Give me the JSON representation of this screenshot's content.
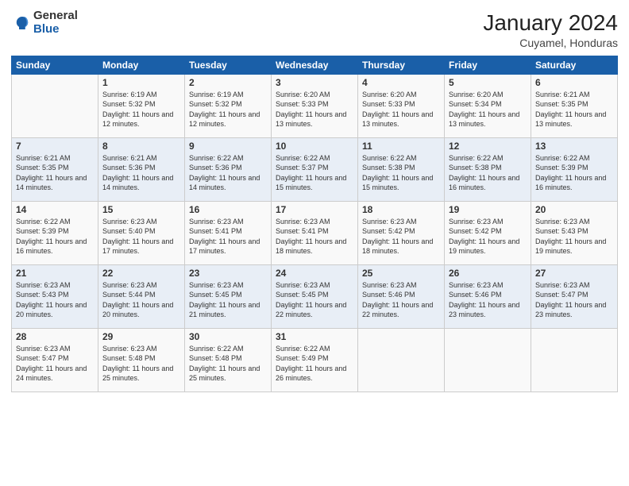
{
  "header": {
    "logo_general": "General",
    "logo_blue": "Blue",
    "title": "January 2024",
    "location": "Cuyamel, Honduras"
  },
  "weekdays": [
    "Sunday",
    "Monday",
    "Tuesday",
    "Wednesday",
    "Thursday",
    "Friday",
    "Saturday"
  ],
  "weeks": [
    [
      {
        "day": "",
        "sunrise": "",
        "sunset": "",
        "daylight": ""
      },
      {
        "day": "1",
        "sunrise": "6:19 AM",
        "sunset": "5:32 PM",
        "daylight": "11 hours and 12 minutes."
      },
      {
        "day": "2",
        "sunrise": "6:19 AM",
        "sunset": "5:32 PM",
        "daylight": "11 hours and 12 minutes."
      },
      {
        "day": "3",
        "sunrise": "6:20 AM",
        "sunset": "5:33 PM",
        "daylight": "11 hours and 13 minutes."
      },
      {
        "day": "4",
        "sunrise": "6:20 AM",
        "sunset": "5:33 PM",
        "daylight": "11 hours and 13 minutes."
      },
      {
        "day": "5",
        "sunrise": "6:20 AM",
        "sunset": "5:34 PM",
        "daylight": "11 hours and 13 minutes."
      },
      {
        "day": "6",
        "sunrise": "6:21 AM",
        "sunset": "5:35 PM",
        "daylight": "11 hours and 13 minutes."
      }
    ],
    [
      {
        "day": "7",
        "sunrise": "6:21 AM",
        "sunset": "5:35 PM",
        "daylight": "11 hours and 14 minutes."
      },
      {
        "day": "8",
        "sunrise": "6:21 AM",
        "sunset": "5:36 PM",
        "daylight": "11 hours and 14 minutes."
      },
      {
        "day": "9",
        "sunrise": "6:22 AM",
        "sunset": "5:36 PM",
        "daylight": "11 hours and 14 minutes."
      },
      {
        "day": "10",
        "sunrise": "6:22 AM",
        "sunset": "5:37 PM",
        "daylight": "11 hours and 15 minutes."
      },
      {
        "day": "11",
        "sunrise": "6:22 AM",
        "sunset": "5:38 PM",
        "daylight": "11 hours and 15 minutes."
      },
      {
        "day": "12",
        "sunrise": "6:22 AM",
        "sunset": "5:38 PM",
        "daylight": "11 hours and 16 minutes."
      },
      {
        "day": "13",
        "sunrise": "6:22 AM",
        "sunset": "5:39 PM",
        "daylight": "11 hours and 16 minutes."
      }
    ],
    [
      {
        "day": "14",
        "sunrise": "6:22 AM",
        "sunset": "5:39 PM",
        "daylight": "11 hours and 16 minutes."
      },
      {
        "day": "15",
        "sunrise": "6:23 AM",
        "sunset": "5:40 PM",
        "daylight": "11 hours and 17 minutes."
      },
      {
        "day": "16",
        "sunrise": "6:23 AM",
        "sunset": "5:41 PM",
        "daylight": "11 hours and 17 minutes."
      },
      {
        "day": "17",
        "sunrise": "6:23 AM",
        "sunset": "5:41 PM",
        "daylight": "11 hours and 18 minutes."
      },
      {
        "day": "18",
        "sunrise": "6:23 AM",
        "sunset": "5:42 PM",
        "daylight": "11 hours and 18 minutes."
      },
      {
        "day": "19",
        "sunrise": "6:23 AM",
        "sunset": "5:42 PM",
        "daylight": "11 hours and 19 minutes."
      },
      {
        "day": "20",
        "sunrise": "6:23 AM",
        "sunset": "5:43 PM",
        "daylight": "11 hours and 19 minutes."
      }
    ],
    [
      {
        "day": "21",
        "sunrise": "6:23 AM",
        "sunset": "5:43 PM",
        "daylight": "11 hours and 20 minutes."
      },
      {
        "day": "22",
        "sunrise": "6:23 AM",
        "sunset": "5:44 PM",
        "daylight": "11 hours and 20 minutes."
      },
      {
        "day": "23",
        "sunrise": "6:23 AM",
        "sunset": "5:45 PM",
        "daylight": "11 hours and 21 minutes."
      },
      {
        "day": "24",
        "sunrise": "6:23 AM",
        "sunset": "5:45 PM",
        "daylight": "11 hours and 22 minutes."
      },
      {
        "day": "25",
        "sunrise": "6:23 AM",
        "sunset": "5:46 PM",
        "daylight": "11 hours and 22 minutes."
      },
      {
        "day": "26",
        "sunrise": "6:23 AM",
        "sunset": "5:46 PM",
        "daylight": "11 hours and 23 minutes."
      },
      {
        "day": "27",
        "sunrise": "6:23 AM",
        "sunset": "5:47 PM",
        "daylight": "11 hours and 23 minutes."
      }
    ],
    [
      {
        "day": "28",
        "sunrise": "6:23 AM",
        "sunset": "5:47 PM",
        "daylight": "11 hours and 24 minutes."
      },
      {
        "day": "29",
        "sunrise": "6:23 AM",
        "sunset": "5:48 PM",
        "daylight": "11 hours and 25 minutes."
      },
      {
        "day": "30",
        "sunrise": "6:22 AM",
        "sunset": "5:48 PM",
        "daylight": "11 hours and 25 minutes."
      },
      {
        "day": "31",
        "sunrise": "6:22 AM",
        "sunset": "5:49 PM",
        "daylight": "11 hours and 26 minutes."
      },
      {
        "day": "",
        "sunrise": "",
        "sunset": "",
        "daylight": ""
      },
      {
        "day": "",
        "sunrise": "",
        "sunset": "",
        "daylight": ""
      },
      {
        "day": "",
        "sunrise": "",
        "sunset": "",
        "daylight": ""
      }
    ]
  ]
}
